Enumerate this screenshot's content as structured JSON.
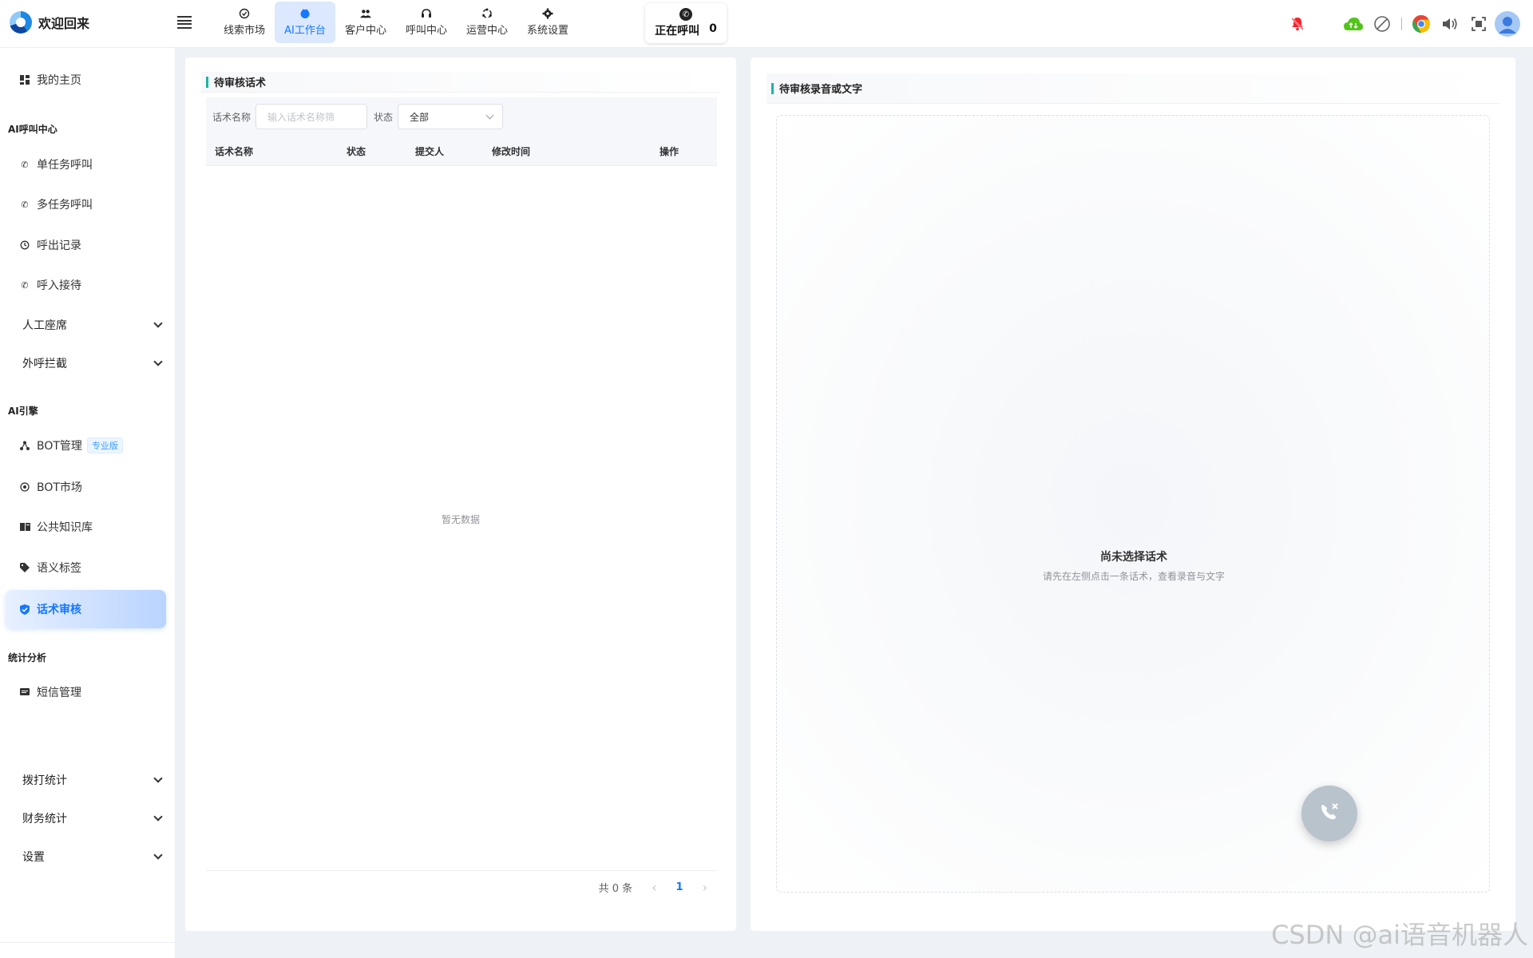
{
  "brand": {
    "title": "欢迎回来"
  },
  "nav": {
    "tabs": [
      {
        "label": "线索市场",
        "icon": "lead-icon"
      },
      {
        "label": "AI工作台",
        "icon": "ai-icon",
        "active": true
      },
      {
        "label": "客户中心",
        "icon": "customers-icon"
      },
      {
        "label": "呼叫中心",
        "icon": "headset-icon"
      },
      {
        "label": "运营中心",
        "icon": "operations-icon"
      },
      {
        "label": "系统设置",
        "icon": "gear-icon"
      }
    ],
    "calling_label": "正在呼叫",
    "calling_count": "0"
  },
  "sidebar": {
    "home": "我的主页",
    "group_ai_call": "AI呼叫中心",
    "single_task": "单任务呼叫",
    "multi_task": "多任务呼叫",
    "outbound_records": "呼出记录",
    "inbound": "呼入接待",
    "manual_seat": "人工座席",
    "outbound_block": "外呼拦截",
    "group_ai_engine": "AI引擎",
    "bot_manage": "BOT管理",
    "bot_manage_badge": "专业版",
    "bot_market": "BOT市场",
    "knowledge": "公共知识库",
    "semantic_tags": "语义标签",
    "script_review": "话术审核",
    "group_stats": "统计分析",
    "sms": "短信管理",
    "dial_stats": "拨打统计",
    "finance_stats": "财务统计",
    "settings": "设置"
  },
  "left_panel": {
    "title": "待审核话术",
    "filter_name_label": "话术名称",
    "filter_name_placeholder": "输入话术名称筛",
    "filter_status_label": "状态",
    "filter_status_value": "全部",
    "columns": [
      "话术名称",
      "状态",
      "提交人",
      "修改时间",
      "操作"
    ],
    "empty_text": "暂无数据",
    "total_text": "共 0 条",
    "current_page": "1"
  },
  "right_panel": {
    "title": "待审核录音或文字",
    "empty_title": "尚未选择话术",
    "empty_sub": "请先在左侧点击一条话术，查看录音与文字"
  },
  "watermark": "CSDN @ai语音机器人",
  "colors": {
    "accent": "#1677ff",
    "teal": "#19b5a6",
    "danger": "#f5222d",
    "green": "#52c41a"
  }
}
